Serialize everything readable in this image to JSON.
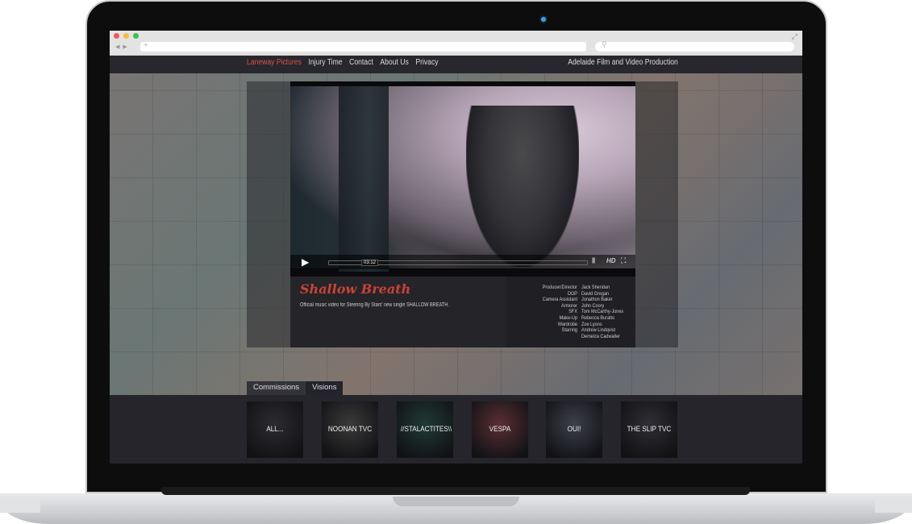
{
  "browser": {
    "window_controls": [
      "close",
      "minimize",
      "zoom"
    ]
  },
  "site": {
    "nav": {
      "items": [
        {
          "label": "Laneway Pictures"
        },
        {
          "label": "Injury Time"
        },
        {
          "label": "Contact"
        },
        {
          "label": "About Us"
        },
        {
          "label": "Privacy"
        }
      ],
      "tagline": "Adelaide Film and Video Production"
    },
    "player": {
      "timecode": "03:12",
      "quality_label": "HD"
    },
    "info": {
      "title": "Shallow Breath",
      "description": "Official music video for Steering By Stars' new single SHALLOW BREATH.",
      "credits": [
        {
          "role": "Producer/Director",
          "name": "Jack Sheridan"
        },
        {
          "role": "DOP",
          "name": "David Gregan"
        },
        {
          "role": "Camera Assistant",
          "name": "Jonathon Baker"
        },
        {
          "role": "Armorer",
          "name": "John Coory"
        },
        {
          "role": "SFX",
          "name": "Tom McCarthy-Jones"
        },
        {
          "role": "Make-Up",
          "name": "Rebecca Buratto"
        },
        {
          "role": "Wardrobe",
          "name": "Zoe Lyons"
        },
        {
          "role": "Starring",
          "name": "Andrew Lindqvist"
        },
        {
          "role": "",
          "name": "Demelza Cadwaller"
        }
      ]
    },
    "tabs": [
      {
        "label": "Commissions"
      },
      {
        "label": "Visions"
      }
    ],
    "thumbnails": [
      {
        "label": "ALL...",
        "color": "#2c2c30"
      },
      {
        "label": "NOONAN TVC",
        "color": "#3a3a3a"
      },
      {
        "label": "//STALACTITES\\\\",
        "color": "#1f3a34"
      },
      {
        "label": "VESPA",
        "color": "#5a2e34"
      },
      {
        "label": "OUI!",
        "color": "#3c4048"
      },
      {
        "label": "THE SLIP TVC",
        "color": "#2e2e34"
      }
    ]
  },
  "colors": {
    "accent": "#c84437",
    "nav_active": "#d8534a",
    "screen_bg": "#222228",
    "camera_led": "#3aa0e8"
  }
}
